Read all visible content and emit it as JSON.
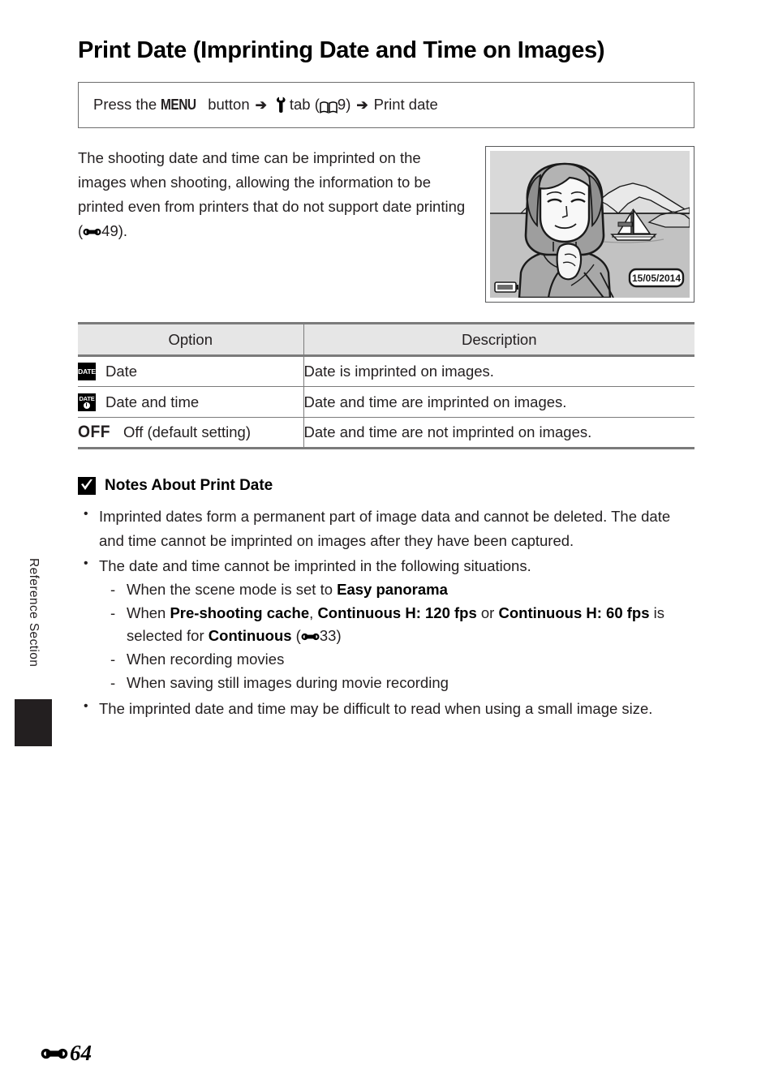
{
  "page": {
    "title": "Print Date (Imprinting Date and Time on Images)",
    "side_tab_label": "Reference Section",
    "footer_page_number": "64",
    "footer_prefix_icon": "e-reference-icon"
  },
  "breadcrumb": {
    "press_the": "Press the",
    "menu": "MENU",
    "button": "button",
    "arrow": "➔",
    "wrench_icon": "setup-tab-wrench-icon",
    "tab": "tab",
    "open_paren": "(",
    "book_icon": "open-book-icon",
    "ref_number": "9",
    "close_paren": ")",
    "arrow2": "➔",
    "destination": "Print date"
  },
  "intro": {
    "text_part1": "The shooting date and time can be imprinted on the images when shooting, allowing the information to be printed even from printers that do not support date printing (",
    "ref_icon": "e-reference-icon",
    "ref_number": "49",
    "text_part2": ")."
  },
  "illustration": {
    "name": "camera-monitor-preview",
    "date_stamp": "15/05/2014",
    "battery_icon": "battery-level-icon",
    "scene_elements": [
      "woman",
      "sailboat",
      "mountains",
      "sea",
      "sky"
    ],
    "colors": {
      "sky": "#d9d9d9",
      "sea": "#c2c2c2",
      "mountain": "#e4e4e4",
      "skin": "#f7f7f7",
      "hair": "#9e9e9e",
      "sweater": "#a8a8a8",
      "outline": "#1a1a1a"
    }
  },
  "table": {
    "headers": [
      "Option",
      "Description"
    ],
    "rows": [
      {
        "icon": "date-imprint-icon",
        "icon_text": "DATE",
        "option": "Date",
        "description": "Date is imprinted on images."
      },
      {
        "icon": "date-and-time-imprint-icon",
        "icon_text": "DATE",
        "option": "Date and time",
        "description": "Date and time are imprinted on images."
      },
      {
        "icon": "off-icon",
        "icon_text": "OFF",
        "option": "Off (default setting)",
        "description": "Date and time are not imprinted on images."
      }
    ]
  },
  "notes": {
    "icon": "caution-check-icon",
    "heading": "Notes About Print Date",
    "bullet1": "Imprinted dates form a permanent part of image data and cannot be deleted. The date and time cannot be imprinted on images after they have been captured.",
    "bullet2": "The date and time cannot be imprinted in the following situations.",
    "sub1_pre": "When the scene mode is set to ",
    "sub1_bold": "Easy panorama",
    "sub2_pre": "When ",
    "sub2_b1": "Pre-shooting cache",
    "sub2_sep1": ", ",
    "sub2_b2": "Continuous H: 120 fps",
    "sub2_sep2": " or ",
    "sub2_b3": "Continuous H: 60 fps",
    "sub2_mid": " is selected for ",
    "sub2_b4": "Continuous",
    "sub2_paren_open": " (",
    "sub2_ref_icon": "e-reference-icon",
    "sub2_ref_num": "33",
    "sub2_paren_close": ")",
    "sub3": "When recording movies",
    "sub4": "When saving still images during movie recording",
    "bullet3": "The imprinted date and time may be difficult to read when using a small image size."
  }
}
